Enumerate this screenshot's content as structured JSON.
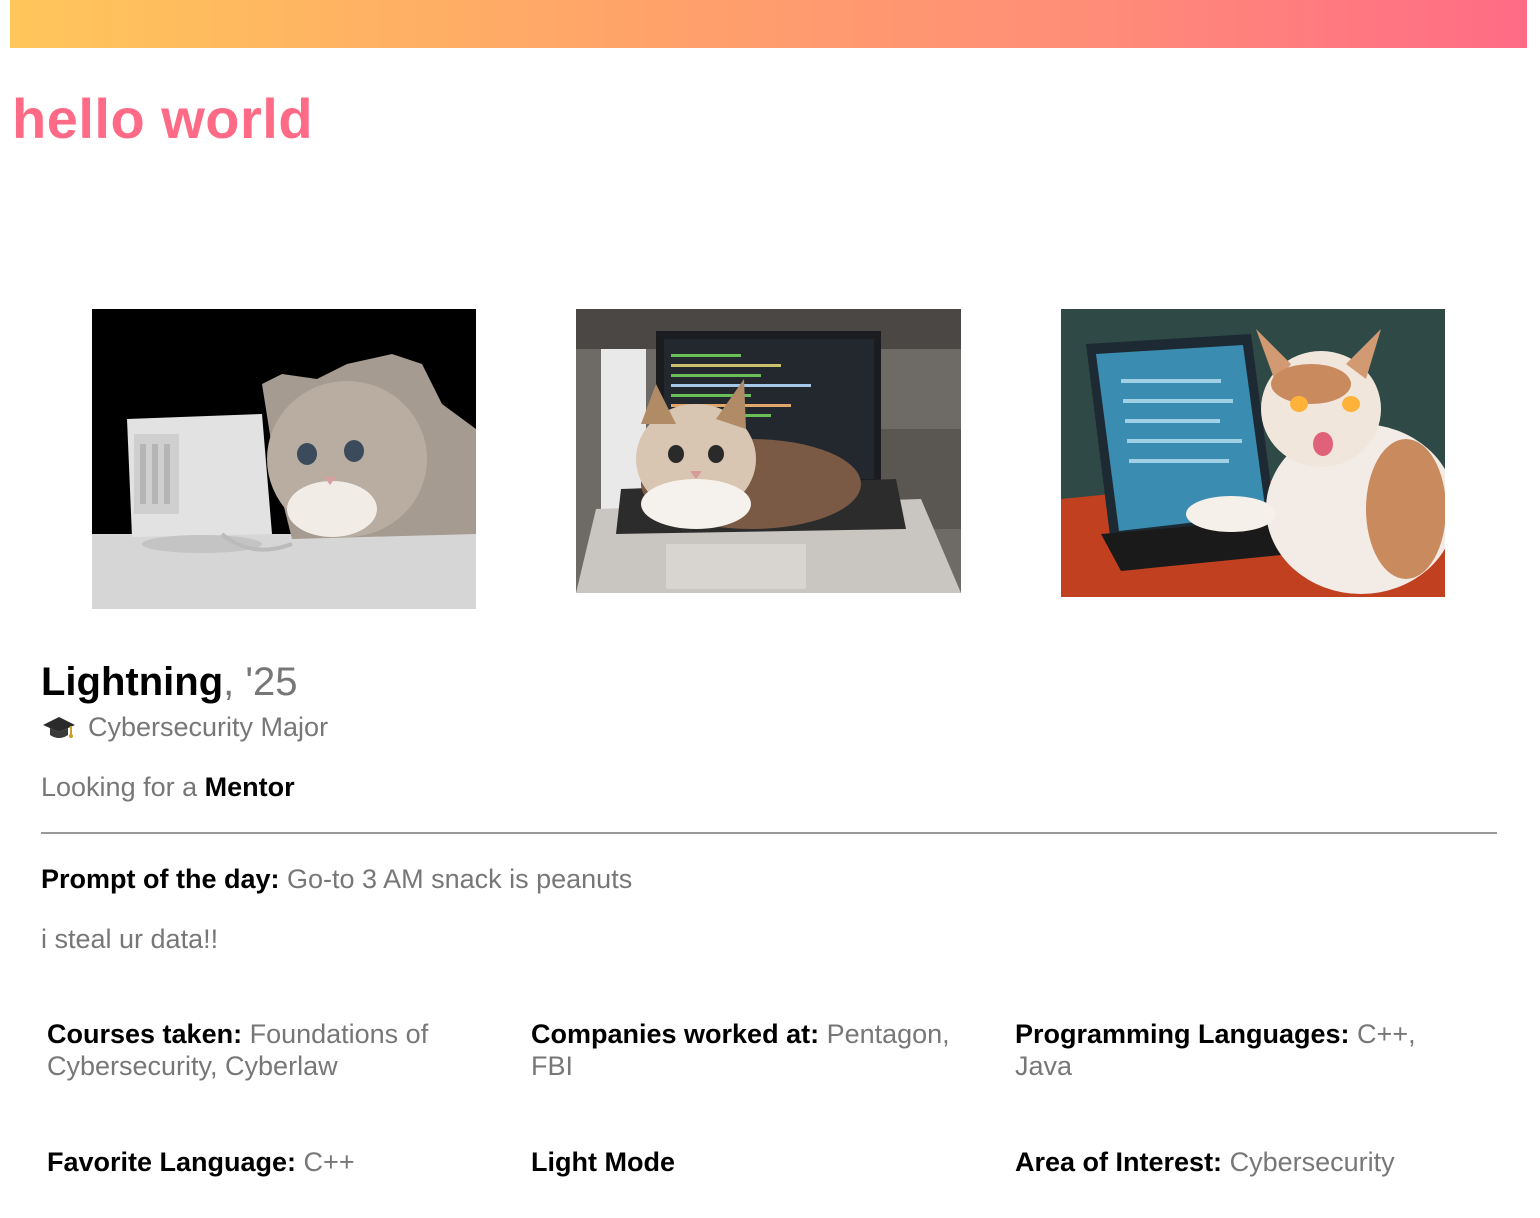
{
  "header": {
    "title": "hello world",
    "bar_gradient": [
      "#ffc65a",
      "#ff6b86"
    ]
  },
  "photos": [
    {
      "alt": "cat next to retro computer"
    },
    {
      "alt": "kitten on laptop keyboard"
    },
    {
      "alt": "cat with glowing eyes beside tablet"
    }
  ],
  "profile": {
    "name": "Lightning",
    "year": ", '25",
    "major_icon": "graduation-cap-icon",
    "major": "Cybersecurity Major",
    "looking_prefix": "Looking for a ",
    "looking_role": "Mentor",
    "prompt_label": "Prompt of the day:",
    "prompt_value": " Go-to 3 AM snack is peanuts",
    "bio": "i steal ur data!!"
  },
  "details": [
    {
      "label": "Courses taken:",
      "value": " Foundations of Cybersecurity, Cyberlaw"
    },
    {
      "label": "Companies worked at:",
      "value": " Pentagon, FBI"
    },
    {
      "label": "Programming Languages:",
      "value": " C++, Java"
    },
    {
      "label": "Favorite Language:",
      "value": " C++"
    },
    {
      "label": "Light Mode",
      "value": ""
    },
    {
      "label": "Area of Interest:",
      "value": " Cybersecurity"
    }
  ],
  "colors": {
    "accent": "#ff6b86",
    "muted_text": "#777777",
    "divider": "#999999"
  }
}
